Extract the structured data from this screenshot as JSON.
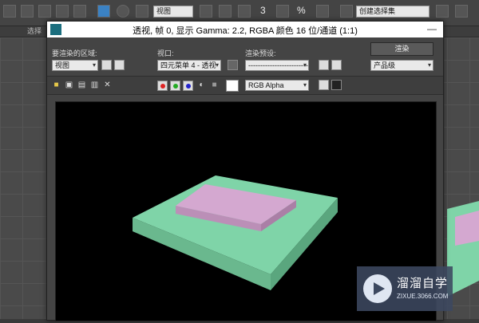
{
  "main_toolbar": {
    "ref_coord_value": "视图",
    "snap_label": "3",
    "percent_label": "%",
    "named_selection": "创建选择集"
  },
  "ribbon": {
    "label": "选择"
  },
  "dialog": {
    "title": "透视, 帧 0, 显示 Gamma: 2.2, RGBA 颜色 16 位/通道 (1:1)",
    "area_label": "要渲染的区域:",
    "area_value": "视图",
    "viewport_label": "视口:",
    "viewport_value": "四元菜单 4 - 透视",
    "preset_label": "渲染预设:",
    "preset_value": "-------------------------",
    "render_button": "渲染",
    "quality_value": "产品级",
    "channel_value": "RGB Alpha",
    "close_icon_char": "✕"
  },
  "colors": {
    "base_slab": "#7fd4a8",
    "top_box": "#d4a8d0",
    "canvas_bg": "#000000"
  },
  "watermark": {
    "title": "溜溜自学",
    "subtitle": "ZIXUE.3066.COM"
  }
}
